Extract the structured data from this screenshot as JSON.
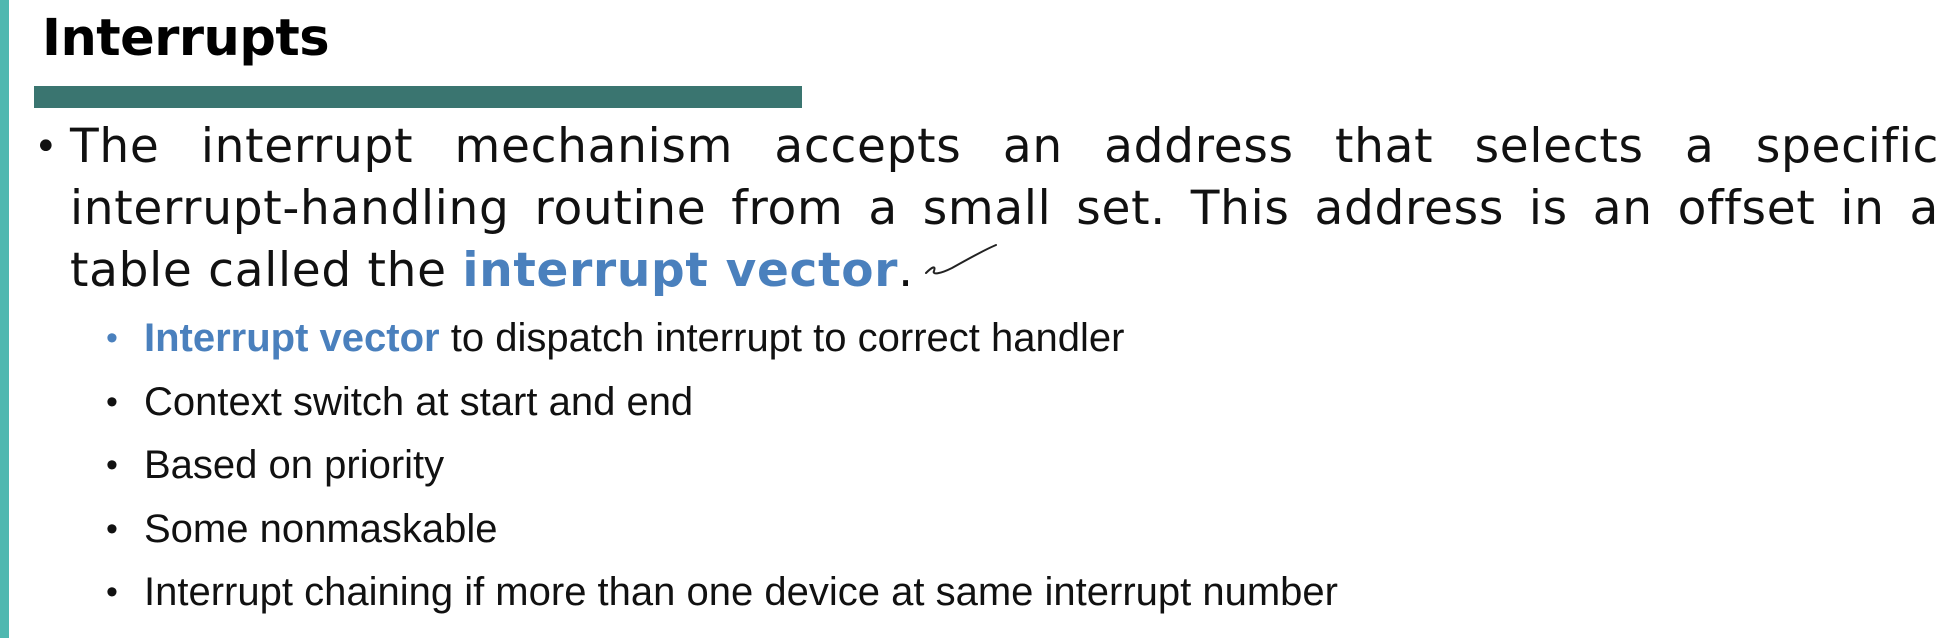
{
  "slide": {
    "title": "Interrupts",
    "main_point": {
      "text_before": "The interrupt mechanism accepts an address that selects a specific interrupt-handling routine from a small set. This address is an offset in a table called the",
      "highlight": "interrupt vector",
      "text_after": "."
    },
    "sub_points": [
      {
        "highlight": "Interrupt vector",
        "text": "to dispatch interrupt to correct handler"
      },
      {
        "text": "Context switch at start and end"
      },
      {
        "text": "Based on priority"
      },
      {
        "text": "Some nonmaskable"
      },
      {
        "text": "Interrupt chaining if more than one device at same interrupt number"
      }
    ],
    "bullet_char": "•"
  },
  "colors": {
    "accent_blue": "#4a80bd",
    "title_bar": "#3a7570",
    "left_accent": "#4fb8b0"
  },
  "icons": {
    "annotation": "handwritten-checkmark-icon"
  }
}
